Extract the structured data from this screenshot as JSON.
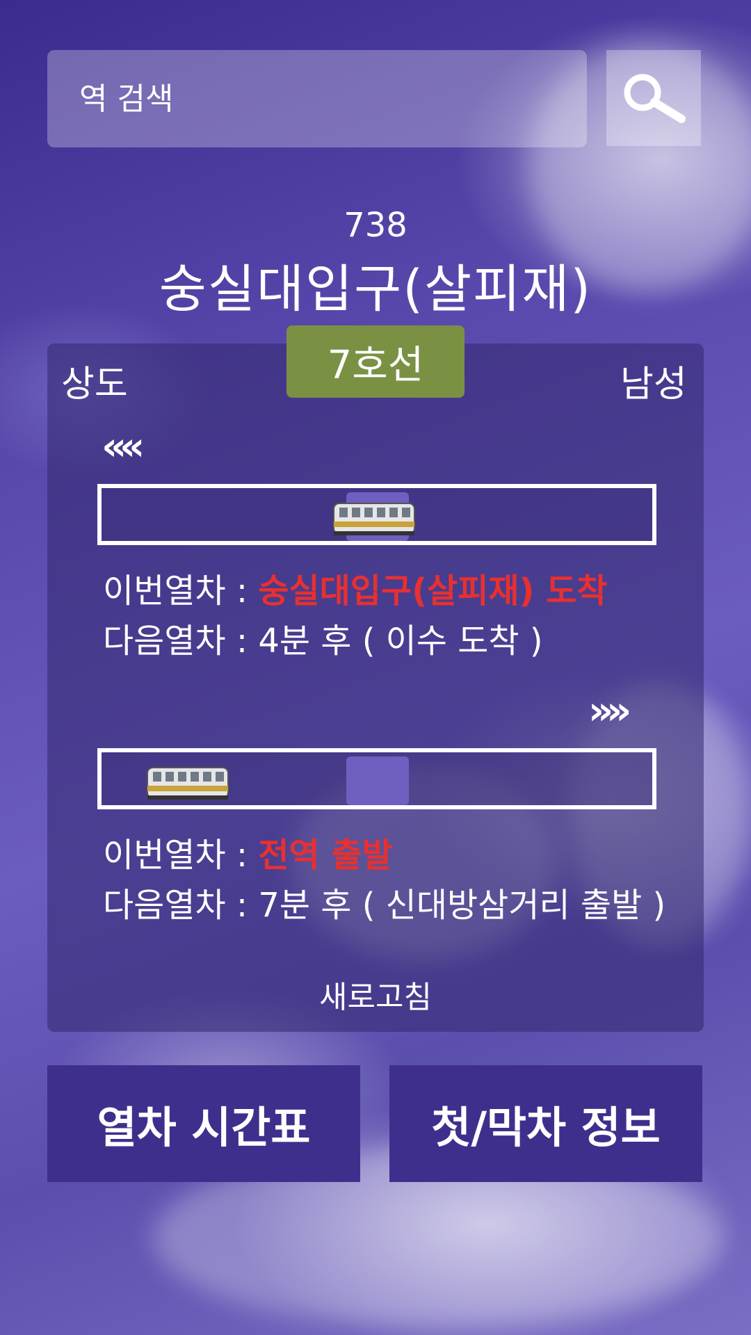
{
  "search": {
    "placeholder": "역 검색"
  },
  "station": {
    "code": "738",
    "name": "숭실대입구(살피재)"
  },
  "line": {
    "name": "7호선",
    "color": "#7a9144"
  },
  "directions": {
    "left": "상도",
    "right": "남성"
  },
  "upbound": {
    "arrows": "‹‹‹‹",
    "this_train_label": "이번열차 : ",
    "this_train_status": "숭실대입구(살피재) 도착",
    "next_train_label": "다음열차 : ",
    "next_train_status": "4분 후 ( 이수 도착 )"
  },
  "downbound": {
    "arrows": "››››",
    "this_train_label": "이번열차 : ",
    "this_train_status": "전역 출발",
    "next_train_label": "다음열차 : ",
    "next_train_status": "7분 후 ( 신대방삼거리 출발 )"
  },
  "refresh_label": "새로고침",
  "buttons": {
    "timetable": "열차 시간표",
    "first_last": "첫/막차 정보"
  },
  "colors": {
    "highlight": "#e8302f",
    "button_bg": "#3f2f8c"
  }
}
